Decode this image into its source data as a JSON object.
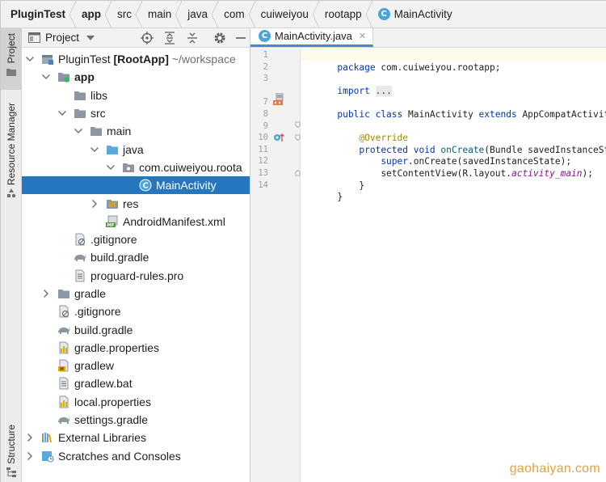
{
  "breadcrumb": [
    "PluginTest",
    "app",
    "src",
    "main",
    "java",
    "com",
    "cuiweiyou",
    "rootapp",
    "MainActivity"
  ],
  "tool_stripe": {
    "project": "Project",
    "resource_manager": "Resource Manager",
    "structure": "Structure"
  },
  "project_panel": {
    "title": "Project",
    "tree": [
      {
        "label": "PluginTest",
        "extra_bold": "[RootApp]",
        "extra": "~/workspace",
        "arrow": "down",
        "icon": "module-icon"
      },
      {
        "label": "app",
        "arrow": "down",
        "icon": "module-folder-icon",
        "bold": true
      },
      {
        "label": "libs",
        "icon": "folder-icon"
      },
      {
        "label": "src",
        "arrow": "down",
        "icon": "folder-icon"
      },
      {
        "label": "main",
        "arrow": "down",
        "icon": "folder-icon"
      },
      {
        "label": "java",
        "arrow": "down",
        "icon": "source-folder-icon"
      },
      {
        "label": "com.cuiweiyou.roota",
        "arrow": "down",
        "icon": "package-icon"
      },
      {
        "label": "MainActivity",
        "icon": "class-icon",
        "selected": true
      },
      {
        "label": "res",
        "arrow": "right",
        "icon": "res-folder-icon"
      },
      {
        "label": "AndroidManifest.xml",
        "icon": "manifest-icon"
      },
      {
        "label": ".gitignore",
        "icon": "gitignore-icon"
      },
      {
        "label": "build.gradle",
        "icon": "gradle-icon"
      },
      {
        "label": "proguard-rules.pro",
        "icon": "text-file-icon"
      },
      {
        "label": "gradle",
        "arrow": "right",
        "icon": "folder-icon"
      },
      {
        "label": ".gitignore",
        "icon": "gitignore-icon"
      },
      {
        "label": "build.gradle",
        "icon": "gradle-icon"
      },
      {
        "label": "gradle.properties",
        "icon": "properties-icon"
      },
      {
        "label": "gradlew",
        "icon": "shell-icon"
      },
      {
        "label": "gradlew.bat",
        "icon": "bat-icon"
      },
      {
        "label": "local.properties",
        "icon": "properties-icon"
      },
      {
        "label": "settings.gradle",
        "icon": "gradle-icon"
      },
      {
        "label": "External Libraries",
        "arrow": "right",
        "icon": "libraries-icon"
      },
      {
        "label": "Scratches and Consoles",
        "arrow": "right",
        "icon": "scratches-icon"
      }
    ]
  },
  "editor": {
    "tab_label": "MainActivity.java",
    "line_numbers": [
      "1",
      "2",
      "3",
      "7",
      "8",
      "9",
      "10",
      "11",
      "12",
      "13",
      "14"
    ],
    "code": {
      "l1_kw": "package",
      "l1_rest": " com.cuiweiyou.rootapp;",
      "l3_kw": "import",
      "l3_fold": "...",
      "l7_kw1": "public class",
      "l7_name": " MainActivity ",
      "l7_kw2": "extends",
      "l7_rest": " AppCompatActivity {",
      "l9_an": "@Override",
      "l10_kw": "protected void",
      "l10_fn": " onCreate",
      "l10_rest": "(Bundle savedInstanceState) {",
      "l11_kw": "super",
      "l11_rest": ".onCreate(savedInstanceState);",
      "l12_pre": "setContentView(R.layout.",
      "l12_it": "activity_main",
      "l12_post": ");",
      "l13": "}",
      "l14": "}"
    }
  },
  "watermark": "gaohaiyan.com",
  "colors": {
    "selection": "#2675bf",
    "keyword": "#0033b3",
    "annotation": "#9e880d",
    "function": "#00627a",
    "italic_field": "#871094",
    "watermark": "#e6a23c"
  }
}
